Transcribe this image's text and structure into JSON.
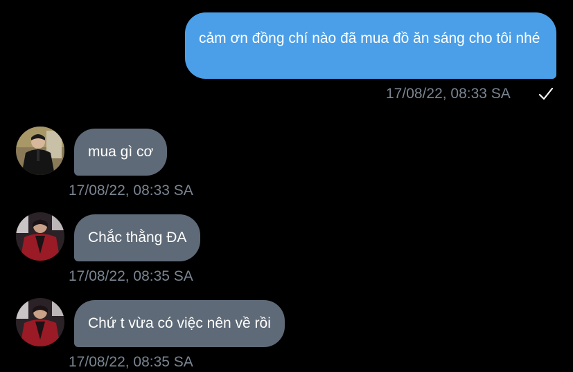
{
  "colors": {
    "background": "#000000",
    "outgoing_bubble": "#4a9fe8",
    "incoming_bubble": "#5e6a77",
    "timestamp": "#7a8592"
  },
  "messages": [
    {
      "direction": "outgoing",
      "text": "cảm ơn đồng chí nào đã mua đồ ăn sáng cho tôi nhé",
      "timestamp": "17/08/22, 08:33 SA",
      "status_icon": "checkmark-icon"
    },
    {
      "direction": "incoming",
      "avatar": "avatar-user-1",
      "text": "mua gì cơ",
      "timestamp": "17/08/22, 08:33 SA"
    },
    {
      "direction": "incoming",
      "avatar": "avatar-user-2",
      "text": "Chắc thằng ĐA",
      "timestamp": "17/08/22, 08:35 SA"
    },
    {
      "direction": "incoming",
      "avatar": "avatar-user-2",
      "text": "Chứ t vừa có việc nên về rồi",
      "timestamp": "17/08/22, 08:35 SA"
    }
  ]
}
